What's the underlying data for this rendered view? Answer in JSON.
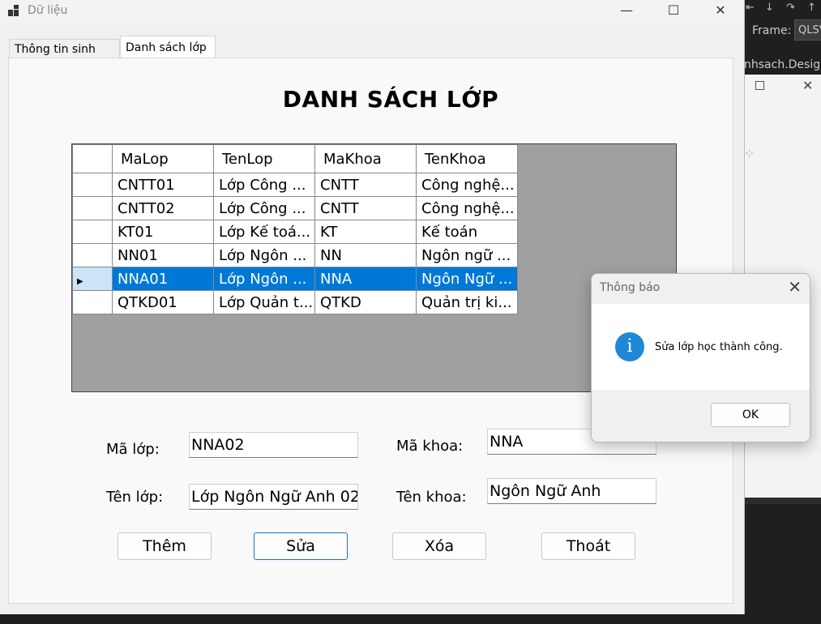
{
  "window": {
    "title": "Dữ liệu",
    "controls": [
      "minimize-icon",
      "maximize-icon",
      "close-icon"
    ]
  },
  "tabs": [
    {
      "label": "Thông tin sinh viên",
      "active": false
    },
    {
      "label": "Danh sách lớp",
      "active": true
    }
  ],
  "page_title": "DANH SÁCH LỚP",
  "grid": {
    "columns": [
      "MaLop",
      "TenLop",
      "MaKhoa",
      "TenKhoa"
    ],
    "rows": [
      [
        "CNTT01",
        "Lớp Công ...",
        "CNTT",
        "Công nghệ..."
      ],
      [
        "CNTT02",
        "Lớp Công ...",
        "CNTT",
        "Công nghệ..."
      ],
      [
        "KT01",
        "Lớp Kế toá...",
        "KT",
        "Kế toán"
      ],
      [
        "NN01",
        "Lớp Ngôn ...",
        "NN",
        "Ngôn ngữ ..."
      ],
      [
        "NNA01",
        "Lớp Ngôn ...",
        "NNA",
        "Ngôn Ngữ ..."
      ],
      [
        "QTKD01",
        "Lớp Quản t...",
        "QTKD",
        "Quản trị ki..."
      ]
    ],
    "selected_row": 4
  },
  "form": {
    "ma_lop_label": "Mã lớp:",
    "ma_lop_value": "NNA02",
    "ten_lop_label": "Tên lớp:",
    "ten_lop_value": "Lớp Ngôn Ngữ Anh 02",
    "ma_khoa_label": "Mã khoa:",
    "ma_khoa_value": "NNA",
    "ten_khoa_label": "Tên khoa:",
    "ten_khoa_value": "Ngôn Ngữ Anh"
  },
  "buttons": {
    "them": "Thêm",
    "sua": "Sửa",
    "xoa": "Xóa",
    "thoat": "Thoát"
  },
  "dialog": {
    "title": "Thông báo",
    "message": "Sửa lớp học thành công.",
    "ok": "OK",
    "icon": "info-icon"
  },
  "ide": {
    "frame_label": "Frame:",
    "frame_value": "QLSV",
    "file_tab": "nhsach.Designer"
  }
}
